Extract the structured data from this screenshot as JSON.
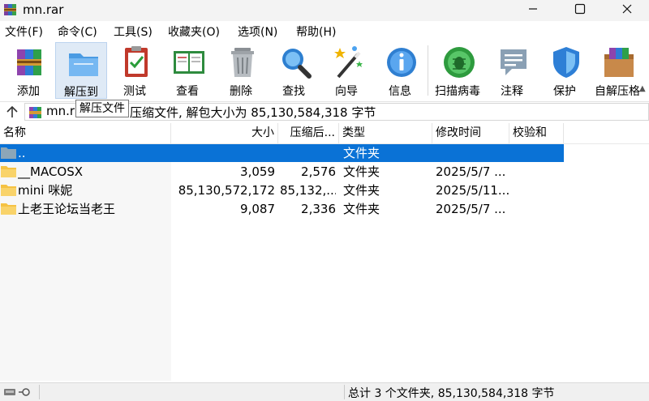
{
  "window": {
    "title": "mn.rar"
  },
  "menu": [
    "文件(F)",
    "命令(C)",
    "工具(S)",
    "收藏夹(O)",
    "选项(N)",
    "帮助(H)"
  ],
  "toolbar": [
    {
      "label": "添加",
      "icon": "add-archive-icon"
    },
    {
      "label": "解压到",
      "icon": "extract-to-icon",
      "active": true
    },
    {
      "label": "测试",
      "icon": "test-icon"
    },
    {
      "label": "查看",
      "icon": "view-icon"
    },
    {
      "label": "删除",
      "icon": "delete-icon"
    },
    {
      "label": "查找",
      "icon": "find-icon"
    },
    {
      "label": "向导",
      "icon": "wizard-icon"
    },
    {
      "label": "信息",
      "icon": "info-icon"
    },
    {
      "label": "扫描病毒",
      "icon": "virus-scan-icon"
    },
    {
      "label": "注释",
      "icon": "comment-icon"
    },
    {
      "label": "保护",
      "icon": "protect-icon"
    },
    {
      "label": "自解压格",
      "icon": "sfx-icon"
    }
  ],
  "address": {
    "name": "mn.ra",
    "description": "压缩文件, 解包大小为 85,130,584,318 字节"
  },
  "tooltip": "解压文件",
  "columns": [
    "名称",
    "大小",
    "压缩后...",
    "类型",
    "修改时间",
    "校验和"
  ],
  "rows": [
    {
      "name": "..",
      "size": "",
      "packed": "",
      "type": "文件夹",
      "modified": "",
      "selected": true,
      "icon": "parent-folder-icon"
    },
    {
      "name": "__MACOSX",
      "size": "3,059",
      "packed": "2,576",
      "type": "文件夹",
      "modified": "2025/5/7 ...",
      "selected": false,
      "icon": "folder-icon"
    },
    {
      "name": "mini 咪妮",
      "size": "85,130,572,172",
      "packed": "85,132,...",
      "type": "文件夹",
      "modified": "2025/5/11...",
      "selected": false,
      "icon": "folder-icon"
    },
    {
      "name": "上老王论坛当老王",
      "size": "9,087",
      "packed": "2,336",
      "type": "文件夹",
      "modified": "2025/5/7 ...",
      "selected": false,
      "icon": "folder-icon"
    }
  ],
  "status": {
    "summary": "总计 3 个文件夹, 85,130,584,318 字节"
  },
  "colors": {
    "selection": "#0a72d6",
    "folder": "#f5c243"
  }
}
